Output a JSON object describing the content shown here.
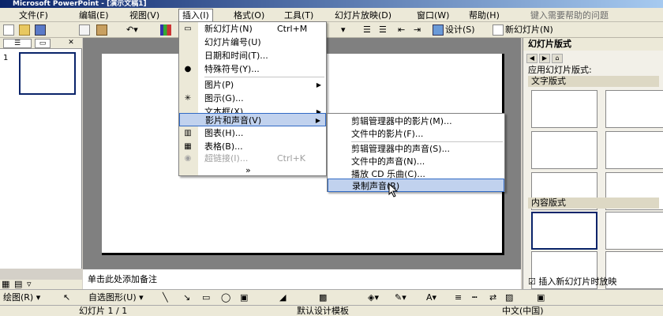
{
  "window": {
    "title": "Microsoft PowerPoint - [演示文稿1]"
  },
  "menubar": {
    "items": [
      {
        "label": "文件(F)"
      },
      {
        "label": "编辑(E)"
      },
      {
        "label": "视图(V)"
      },
      {
        "label": "插入(I)"
      },
      {
        "label": "格式(O)"
      },
      {
        "label": "工具(T)"
      },
      {
        "label": "幻灯片放映(D)"
      },
      {
        "label": "窗口(W)"
      },
      {
        "label": "帮助(H)"
      }
    ],
    "help_placeholder": "键入需要帮助的问题"
  },
  "toolbar": {
    "design_label": "设计(S)",
    "new_slide_label": "新幻灯片(N)"
  },
  "insert_menu": {
    "items": [
      {
        "label": "新幻灯片(N)",
        "shortcut": "Ctrl+M"
      },
      {
        "label": "幻灯片编号(U)"
      },
      {
        "label": "日期和时间(T)..."
      },
      {
        "label": "特殊符号(Y)..."
      },
      {
        "label": "图片(P)"
      },
      {
        "label": "图示(G)..."
      },
      {
        "label": "文本框(X)"
      },
      {
        "label": "影片和声音(V)"
      },
      {
        "label": "图表(H)..."
      },
      {
        "label": "表格(B)..."
      },
      {
        "label": "超链接(I)...",
        "shortcut": "Ctrl+K"
      }
    ],
    "more": "»"
  },
  "media_submenu": {
    "items": [
      {
        "label": "剪辑管理器中的影片(M)..."
      },
      {
        "label": "文件中的影片(F)..."
      },
      {
        "label": "剪辑管理器中的声音(S)..."
      },
      {
        "label": "文件中的声音(N)..."
      },
      {
        "label": "播放 CD 乐曲(C)..."
      },
      {
        "label": "录制声音(R)"
      }
    ]
  },
  "slides_pane": {
    "slide_number": "1"
  },
  "notes": {
    "placeholder": "单击此处添加备注"
  },
  "task_pane": {
    "title": "幻灯片版式",
    "apply_label": "应用幻灯片版式:",
    "section_text": "文字版式",
    "section_content": "内容版式",
    "checkbox_label": "插入新幻灯片时放映"
  },
  "drawbar": {
    "draw_label": "绘图(R)",
    "autoshape_label": "自选图形(U)"
  },
  "status": {
    "slide": "幻灯片 1 / 1",
    "design": "默认设计模板",
    "language": "中文(中国)"
  },
  "colors": {
    "title_start": "#0a246a",
    "highlight": "#c1d2ee",
    "highlight_border": "#316ac5"
  }
}
